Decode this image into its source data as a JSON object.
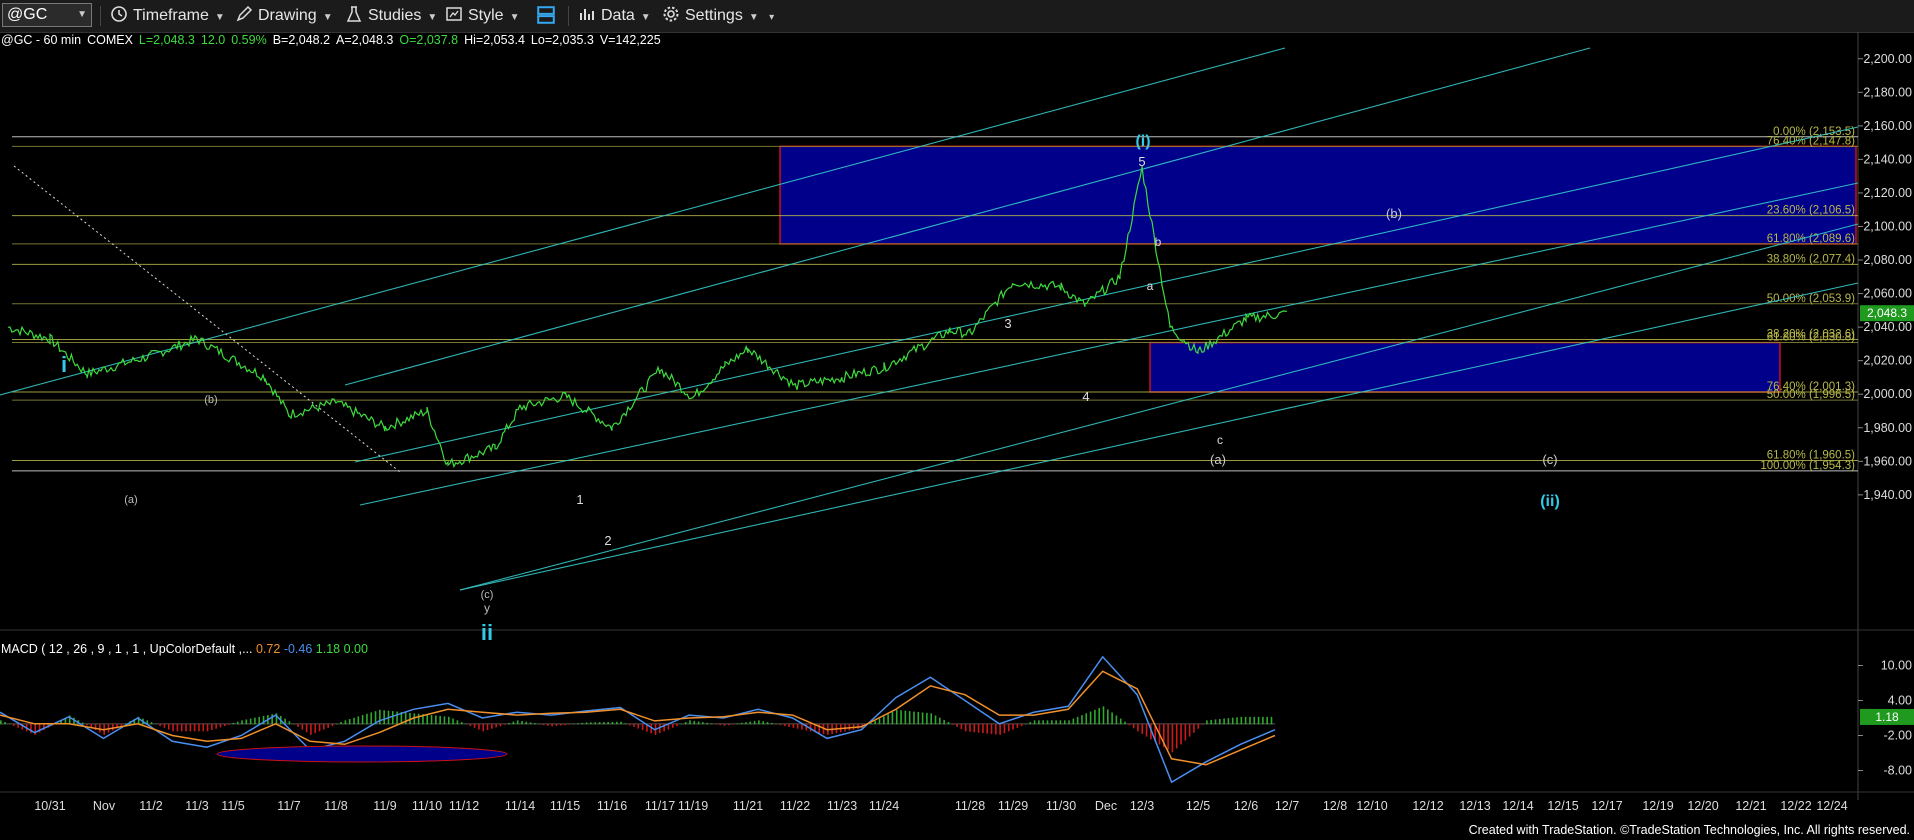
{
  "toolbar": {
    "symbol": "@GC",
    "timeframe": "Timeframe",
    "drawing": "Drawing",
    "studies": "Studies",
    "style": "Style",
    "data": "Data",
    "settings": "Settings"
  },
  "quote": {
    "symbol": "@GC - 60 min",
    "exchange": "COMEX",
    "last": "L=2,048.3",
    "change": "12.0",
    "pct": "0.59%",
    "bid": "B=2,048.2",
    "ask": "A=2,048.3",
    "open": "O=2,037.8",
    "high": "Hi=2,053.4",
    "low": "Lo=2,035.3",
    "volume": "V=142,225"
  },
  "macd_label": {
    "name": "MACD ( 12 , 26 , 9 , 1 , 1 , UpColorDefault ,...",
    "v1": "0.72",
    "v2": "-0.46",
    "v3": "1.18",
    "v4": "0.00"
  },
  "credit": "Created with TradeStation. ©TradeStation Technologies, Inc. All rights reserved.",
  "colors": {
    "background": "#000000",
    "price": "#3ddc3d",
    "channel": "#35c8c8",
    "box_fill": "#00008b",
    "box_border": "#cc1111",
    "fib": "#b8b84a",
    "macd_line": "#4a8ff0",
    "signal_line": "#f0902a",
    "hist_up": "#2faa2f",
    "hist_down": "#cc1a1a",
    "wave_label": "#35c8e8"
  },
  "chart_data": {
    "type": "line",
    "title": "@GC - 60 min",
    "ylim": [
      1925,
      2210
    ],
    "y_ticks": [
      "2,200.00",
      "2,180.00",
      "2,160.00",
      "2,140.00",
      "2,120.00",
      "2,100.00",
      "2,080.00",
      "2,060.00",
      "2,040.00",
      "2,020.00",
      "2,000.00",
      "1,980.00",
      "1,960.00",
      "1,940.00"
    ],
    "x_ticks": [
      "10/31",
      "Nov",
      "11/2",
      "11/3",
      "11/5",
      "11/7",
      "11/8",
      "11/9",
      "11/10",
      "11/12",
      "11/14",
      "11/15",
      "11/16",
      "11/17",
      "11/19",
      "11/21",
      "11/22",
      "11/23",
      "11/24",
      "11/28",
      "11/29",
      "11/30",
      "Dec",
      "12/3",
      "12/5",
      "12/6",
      "12/7",
      "12/8",
      "12/10",
      "12/12",
      "12/13",
      "12/14",
      "12/15",
      "12/17",
      "12/19",
      "12/20",
      "12/21",
      "12/22",
      "12/24"
    ],
    "last_price_tag": "2,048.3",
    "series": [
      {
        "points": [
          [
            "10/30",
            2040
          ],
          [
            "10/31",
            2033
          ],
          [
            "11/1",
            2012
          ],
          [
            "11/2",
            2023
          ],
          [
            "11/3",
            2033
          ],
          [
            "11/6",
            2010
          ],
          [
            "11/7",
            1988
          ],
          [
            "11/8",
            1995
          ],
          [
            "11/9",
            1980
          ],
          [
            "11/10",
            1990
          ],
          [
            "11/11",
            1958
          ],
          [
            "11/13",
            1968
          ],
          [
            "11/14",
            1992
          ],
          [
            "11/15",
            1999
          ],
          [
            "11/16",
            1980
          ],
          [
            "11/17",
            2015
          ],
          [
            "11/19",
            1998
          ],
          [
            "11/20",
            2017
          ],
          [
            "11/21",
            2027
          ],
          [
            "11/22",
            2005
          ],
          [
            "11/23",
            2010
          ],
          [
            "11/24",
            2016
          ],
          [
            "11/27",
            2038
          ],
          [
            "11/28",
            2036
          ],
          [
            "11/29",
            2067
          ],
          [
            "11/30",
            2064
          ],
          [
            "12/1",
            2053
          ],
          [
            "12/2",
            2070
          ],
          [
            "12/3",
            2135
          ],
          [
            "12/4",
            2040
          ],
          [
            "12/5",
            2025
          ],
          [
            "12/6",
            2045
          ],
          [
            "12/7",
            2048.3
          ]
        ]
      }
    ],
    "fib_levels": [
      {
        "label": "0.00% (2,153.5)",
        "value": 2153.5
      },
      {
        "label": "76.40% (2,147.8)",
        "value": 2147.8
      },
      {
        "label": "23.60% (2,106.5)",
        "value": 2106.5
      },
      {
        "label": "61.80% (2,089.6)",
        "value": 2089.6
      },
      {
        "label": "38.80% (2,077.4)",
        "value": 2077.4
      },
      {
        "label": "50.00% (2,053.9)",
        "value": 2053.9
      },
      {
        "label": "38.20% (2,032.6)",
        "value": 2032.6
      },
      {
        "label": "61.80% (2,030.8)",
        "value": 2030.8
      },
      {
        "label": "76.40% (2,001.3)",
        "value": 2001.3
      },
      {
        "label": "50.00% (1,996.5)",
        "value": 1996.5
      },
      {
        "label": "61.80% (1,960.5)",
        "value": 1960.5
      },
      {
        "label": "100.00% (1,954.3)",
        "value": 1954.3
      }
    ],
    "target_boxes": [
      {
        "name": "(b)",
        "y_top": 2147.8,
        "y_bottom": 2089.6,
        "x_from": "11/21",
        "x_to": "12/24"
      },
      {
        "name": "(ii)",
        "y_top": 2030.8,
        "y_bottom": 2001.3,
        "x_from": "12/4",
        "x_to": "12/21"
      }
    ],
    "wave_labels": [
      "i",
      "ii",
      "(i)",
      "(ii)",
      "(a)",
      "(b)",
      "(c)",
      "y",
      "1",
      "2",
      "3",
      "4",
      "5",
      "a",
      "b",
      "c"
    ],
    "macd": {
      "ylim": [
        -11,
        13
      ],
      "y_ticks": [
        "10.00",
        "4.00",
        "-2.00",
        "-8.00"
      ],
      "last_value": "1.18",
      "macd_values": [
        2.0,
        -1.5,
        1.2,
        -2.5,
        1.0,
        -3.0,
        -4.0,
        -2.0,
        1.5,
        -4.5,
        -3.0,
        0.5,
        2.5,
        3.5,
        1.0,
        2.0,
        1.5,
        2.2,
        2.8,
        -1.0,
        1.5,
        1.0,
        2.5,
        1.0,
        -2.5,
        -1.0,
        4.5,
        8.0,
        4.0,
        0.0,
        2.0,
        3.0,
        11.5,
        5.0,
        -10.0,
        -6.5,
        -3.5,
        -1.0
      ],
      "signal_values": [
        1.5,
        0.0,
        0.0,
        -1.0,
        0.0,
        -2.0,
        -3.0,
        -2.5,
        0.0,
        -3.0,
        -3.5,
        -1.5,
        1.0,
        2.5,
        2.0,
        1.5,
        1.8,
        2.0,
        2.5,
        0.5,
        1.0,
        1.2,
        2.0,
        1.5,
        -1.0,
        -0.5,
        2.5,
        6.5,
        5.0,
        1.5,
        1.5,
        2.5,
        9.0,
        6.0,
        -6.0,
        -7.0,
        -4.5,
        -2.0
      ]
    }
  }
}
